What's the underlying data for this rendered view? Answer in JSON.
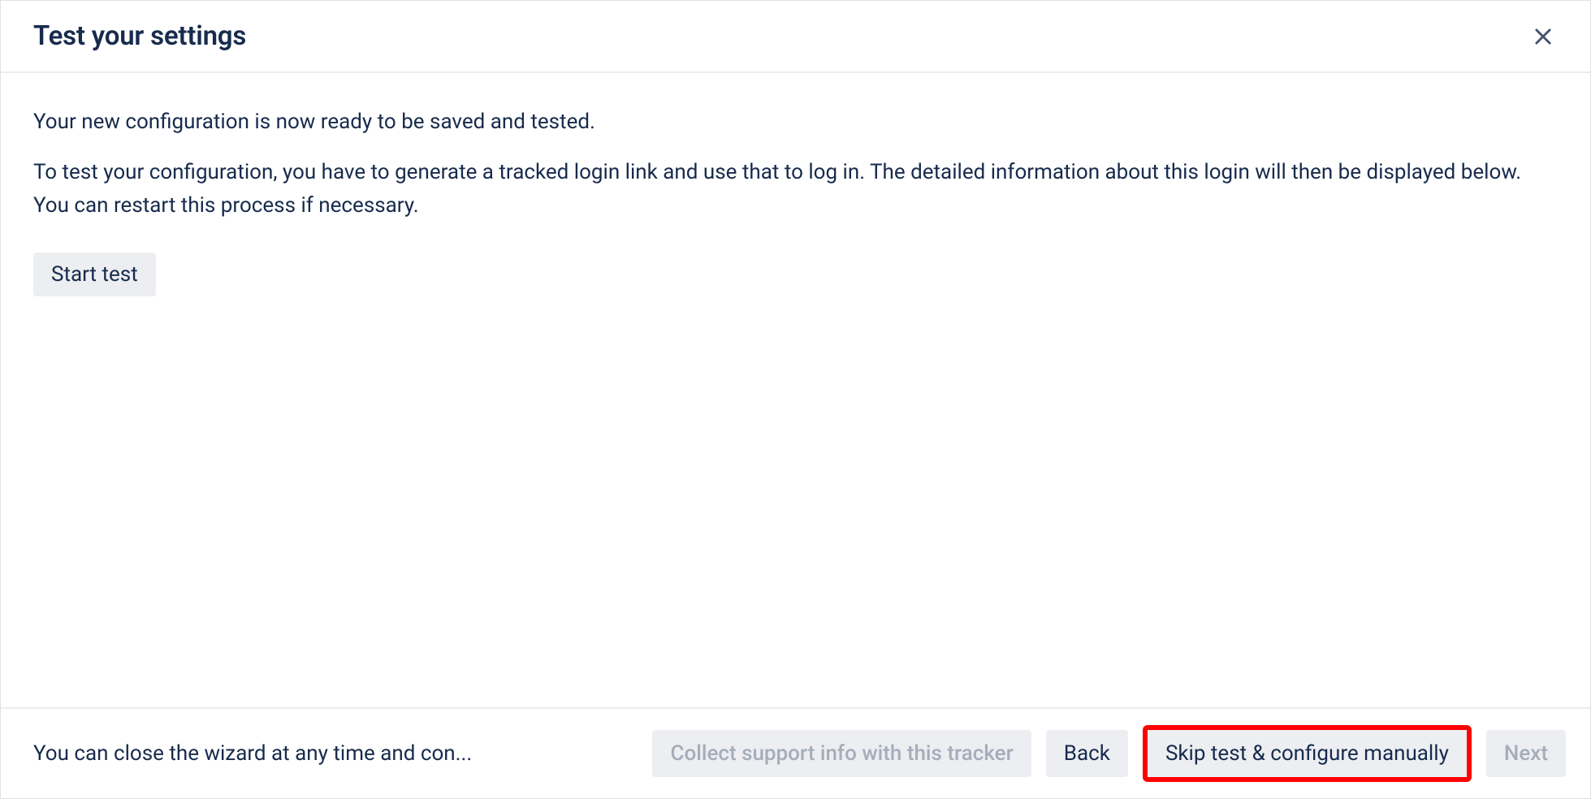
{
  "header": {
    "title": "Test your settings"
  },
  "body": {
    "paragraph1": "Your new configuration is now ready to be saved and tested.",
    "paragraph2": "To test your configuration, you have to generate a tracked login link and use that to log in. The detailed information about this login will then be displayed below. You can restart this process if necessary.",
    "start_test_label": "Start test"
  },
  "footer": {
    "note": "You can close the wizard at any time and con...",
    "collect_support_label": "Collect support info with this tracker",
    "back_label": "Back",
    "skip_label": "Skip test & configure manually",
    "next_label": "Next"
  }
}
